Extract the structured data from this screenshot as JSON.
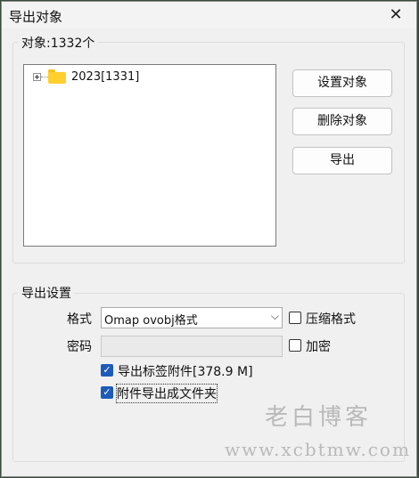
{
  "window": {
    "title": "导出对象",
    "close_icon": "✕"
  },
  "objects_group": {
    "label": "对象:1332个",
    "tree": [
      {
        "label": "2023[1331]",
        "expander": "+",
        "icon": "folder-icon"
      }
    ]
  },
  "buttons": {
    "set_objects": "设置对象",
    "delete_objects": "删除对象",
    "export": "导出"
  },
  "settings_group": {
    "label": "导出设置",
    "format_label": "格式",
    "format_value": "Omap ovobj格式",
    "compress_label": "压缩格式",
    "compress_checked": false,
    "password_label": "密码",
    "password_value": "",
    "encrypt_label": "加密",
    "encrypt_checked": false,
    "export_attachments_label": "导出标签附件[378.9 M]",
    "export_attachments_checked": true,
    "attachments_as_files_label": "附件导出成文件夹",
    "attachments_as_files_checked": true
  },
  "watermark": {
    "line1": "老白博客",
    "line2": "www.xcbtmw.com"
  },
  "colors": {
    "accent": "#1e5bb8",
    "folder": "#ffcf2e"
  }
}
